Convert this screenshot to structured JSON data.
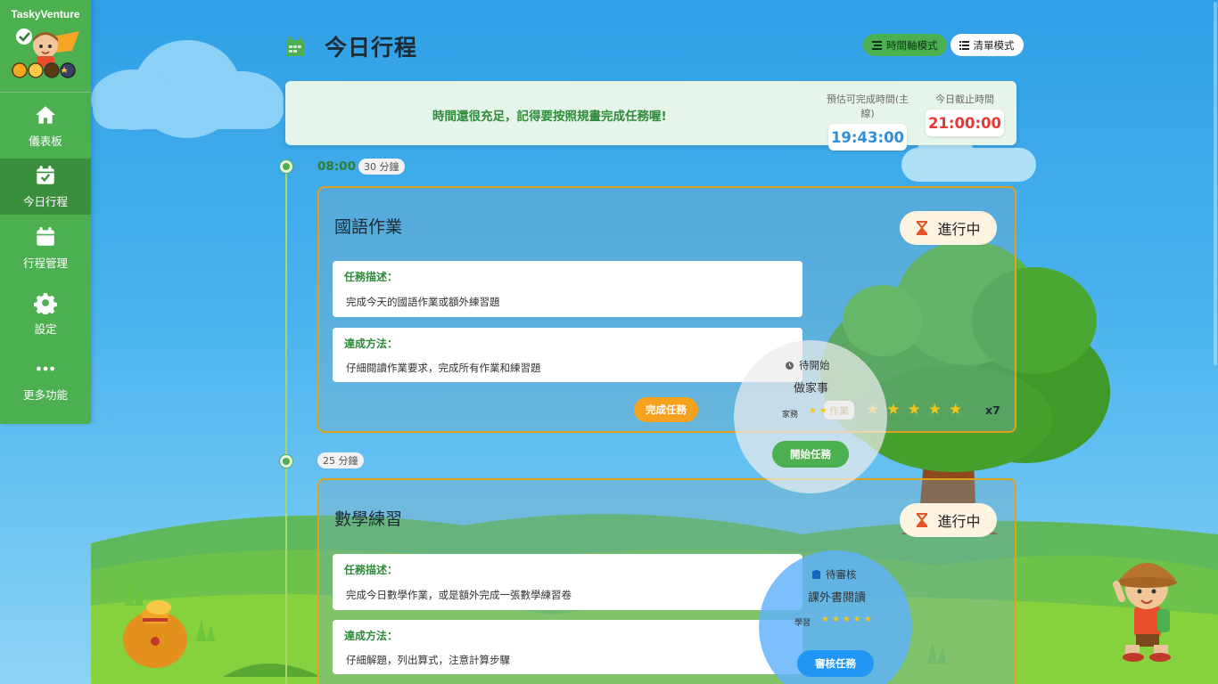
{
  "app": {
    "brand": "TaskyVenture"
  },
  "sidebar": {
    "items": [
      {
        "label": "儀表板",
        "icon": "home-icon"
      },
      {
        "label": "今日行程",
        "icon": "calendar-check-icon",
        "active": true
      },
      {
        "label": "行程管理",
        "icon": "calendar-icon"
      },
      {
        "label": "設定",
        "icon": "gear-icon"
      },
      {
        "label": "更多功能",
        "icon": "more-dots-icon"
      }
    ]
  },
  "header": {
    "title": "今日行程",
    "modes": {
      "timeline": "時間軸模式",
      "list": "清單模式",
      "active": "timeline"
    }
  },
  "notice": {
    "message": "時間還很充足，記得要按照規畫完成任務喔!",
    "estimate_label": "預估可完成時間(主線)",
    "estimate_value": "19:43:00",
    "deadline_label": "今日截止時間",
    "deadline_value": "21:00:00"
  },
  "timeline": {
    "slots": [
      {
        "time": "08:00",
        "duration": "30 分鐘",
        "task": {
          "title": "國語作業",
          "status": "進行中",
          "desc_label": "任務描述：",
          "desc": "完成今天的國語作業或額外練習題",
          "method_label": "達成方法：",
          "method": "仔細閱讀作業要求，完成所有作業和練習題",
          "action": "完成任務"
        }
      },
      {
        "time": "",
        "duration": "25 分鐘",
        "task": {
          "title": "數學練習",
          "status": "進行中",
          "desc_label": "任務描述：",
          "desc": "完成今日數學作業，或是額外完成一張數學練習卷",
          "method_label": "達成方法：",
          "method": "仔細解題，列出算式，注意計算步驟"
        }
      }
    ]
  },
  "overlay": {
    "tag": "作業",
    "stars": "★★★★★",
    "count": "x7"
  },
  "bubbles": [
    {
      "status": "待開始",
      "name": "做家事",
      "category": "家務",
      "stars": "★★",
      "action": "開始任務",
      "color": "#4caf50"
    },
    {
      "status": "待審核",
      "name": "課外書閱讀",
      "category": "學習",
      "stars": "★★★★★",
      "action": "審核任務",
      "color": "#2196f3"
    }
  ]
}
